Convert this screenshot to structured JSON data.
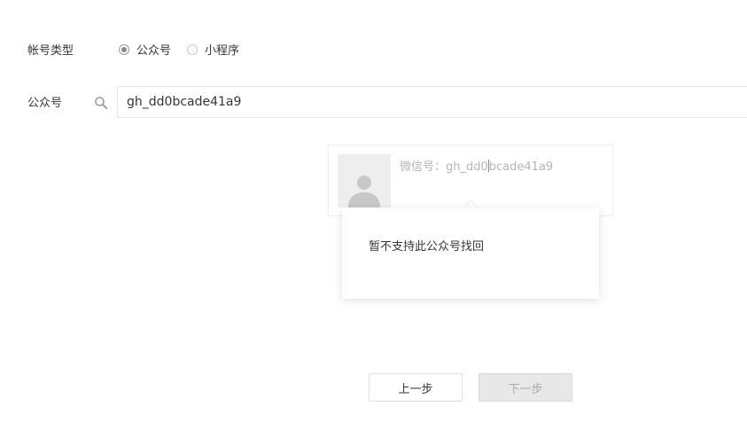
{
  "form": {
    "account_type_label": "帐号类型",
    "account_types": [
      {
        "label": "公众号",
        "checked": true
      },
      {
        "label": "小程序",
        "checked": false
      }
    ],
    "account_label": "公众号",
    "search_value": "gh_dd0bcade41a9"
  },
  "result": {
    "wechat_id_prefix": "微信号：gh_dd0",
    "wechat_id_suffix": "bcade41a9",
    "avatar_icon": "default-avatar-icon"
  },
  "popover": {
    "message": "暂不支持此公众号找回"
  },
  "buttons": {
    "prev": "上一步",
    "next": "下一步"
  }
}
